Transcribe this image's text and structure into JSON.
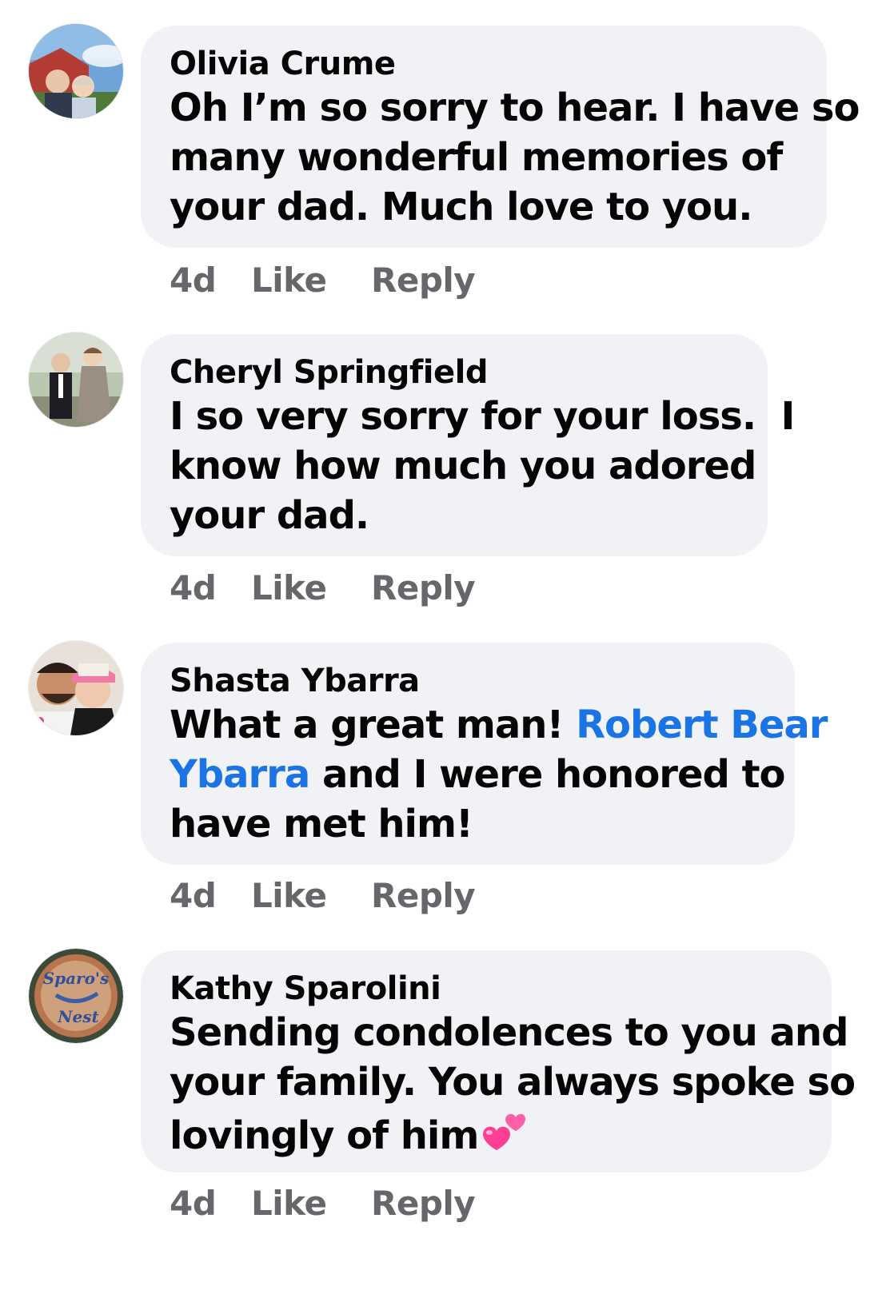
{
  "comments": [
    {
      "author": "Olivia Crume",
      "text_lines": [
        "Oh I’m so sorry to hear. I have so",
        "many wonderful memories of",
        "your dad. Much love to you."
      ],
      "time": "4d",
      "like_label": "Like",
      "reply_label": "Reply"
    },
    {
      "author": "Cheryl Springfield",
      "text_lines": [
        "I so very sorry for your loss.  I",
        "know how much you adored",
        "your dad."
      ],
      "time": "4d",
      "like_label": "Like",
      "reply_label": "Reply"
    },
    {
      "author": "Shasta Ybarra",
      "line1_prefix": "What a great man! ",
      "mention_part1": "Robert Bear",
      "mention_part2": "Ybarra",
      "line2_suffix": " and I were honored to",
      "line3": "have met him!",
      "time": "4d",
      "like_label": "Like",
      "reply_label": "Reply"
    },
    {
      "author": "Kathy Sparolini",
      "text_lines": [
        "Sending condolences to you and",
        "your family. You always spoke so",
        "lovingly of him"
      ],
      "emoji": "two-hearts-emoji",
      "avatar_text": [
        "Sparo's",
        "Nest"
      ],
      "time": "4d",
      "like_label": "Like",
      "reply_label": "Reply"
    }
  ],
  "colors": {
    "bubble": "#f0f2f5",
    "text": "#050505",
    "mention": "#1b74e4",
    "actions": "#65676b"
  }
}
